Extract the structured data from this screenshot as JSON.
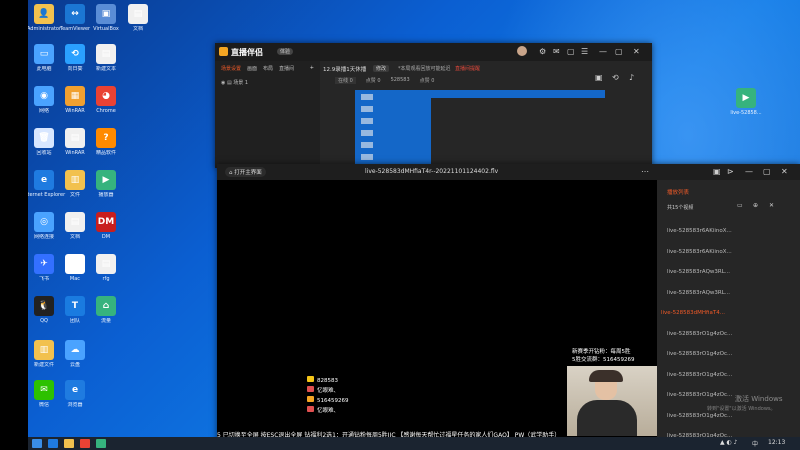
{
  "desktop": {
    "icons": [
      {
        "label": "Administrator",
        "color": "#f2c14e",
        "glyph": "👤"
      },
      {
        "label": "TeamViewer",
        "color": "#1b76d3",
        "glyph": "↔"
      },
      {
        "label": "VirtualBox",
        "color": "#5a8dd6",
        "glyph": "▣"
      },
      {
        "label": "文档",
        "color": "#f0f0f0",
        "glyph": "▤"
      },
      {
        "label": "此电脑",
        "color": "#4aa3ff",
        "glyph": "▭"
      },
      {
        "label": "向日葵",
        "color": "#2aa0ff",
        "glyph": "⟲"
      },
      {
        "label": "新建文本",
        "color": "#f0f0f0",
        "glyph": "▤"
      },
      {
        "label": "网络",
        "color": "#4aa3ff",
        "glyph": "◉"
      },
      {
        "label": "WinRAR",
        "color": "#f0a030",
        "glyph": "▦"
      },
      {
        "label": "Chrome",
        "color": "#e94234",
        "glyph": "◕"
      },
      {
        "label": "回收站",
        "color": "#d7e6ff",
        "glyph": "🗑"
      },
      {
        "label": "WinRAR",
        "color": "#f0f0f0",
        "glyph": "▤"
      },
      {
        "label": "精品软件",
        "color": "#ff8a00",
        "glyph": "?"
      },
      {
        "label": "Internet Explorer",
        "color": "#1f7be0",
        "glyph": "e"
      },
      {
        "label": "文件",
        "color": "#f2c14e",
        "glyph": "▥"
      },
      {
        "label": "播放器",
        "color": "#36b37e",
        "glyph": "▶"
      },
      {
        "label": "网络连接",
        "color": "#4aa3ff",
        "glyph": "◎"
      },
      {
        "label": "文档",
        "color": "#f0f0f0",
        "glyph": "▤"
      },
      {
        "label": "DM",
        "color": "#c81e1e",
        "glyph": "DM"
      },
      {
        "label": "飞书",
        "color": "#3370ff",
        "glyph": "✈"
      },
      {
        "label": "Mac",
        "color": "#ffffff",
        "glyph": "M"
      },
      {
        "label": "rfg",
        "color": "#f0f0f0",
        "glyph": "▤"
      },
      {
        "label": "QQ",
        "color": "#222222",
        "glyph": "🐧"
      },
      {
        "label": "团队",
        "color": "#1a7be0",
        "glyph": "T"
      },
      {
        "label": "流量",
        "color": "#36b37e",
        "glyph": "⌂"
      },
      {
        "label": "新建文件",
        "color": "#f2c14e",
        "glyph": "▥"
      },
      {
        "label": "云盘",
        "color": "#4aa3ff",
        "glyph": "☁"
      },
      {
        "label": "微信",
        "color": "#2dc100",
        "glyph": "✉"
      },
      {
        "label": "浏览器",
        "color": "#1f7be0",
        "glyph": "e"
      }
    ],
    "right_icon": {
      "label": "live-52858..."
    }
  },
  "studio": {
    "logo": "直播伴侣",
    "badge": "体验",
    "tabs": [
      "场景设置",
      "画面",
      "布局",
      "直播间"
    ],
    "add_label": "+",
    "scene_label": "场景 1",
    "live_title": "12.9录播1天休播",
    "edit_label": "修改",
    "notice": "*本局观看回放可能延迟",
    "warn": "直播间提醒",
    "stats": [
      "在线 0",
      "点赞 0",
      "528583",
      "点赞 0"
    ],
    "quick_btn": "录制"
  },
  "player": {
    "open_label": "打开主界面",
    "filename": "live-528583dMHfiaT4r--20221101124402.flv",
    "playlist_title": "播放列表",
    "playlist_count": "共15个视频",
    "items": [
      "live-528583r6AKiinoX...",
      "live-528583r6AKiinoX...",
      "live-528583rAQw3RL...",
      "live-528583rAQw3RL...",
      "live-528583dMHfiaT4...",
      "live-528583rO1g4zOc...",
      "live-528583rO1g4zOc...",
      "live-528583rO1g4zOc...",
      "live-528583rO1g4zOc...",
      "live-528583rO1g4zOc...",
      "live-528583rO1g4zOc..."
    ],
    "active_index": 4,
    "overlay_lines": [
      "新赛季开钻粉：每周5胜",
      "5胜交流群：516459269"
    ],
    "chat_lines": [
      "828583",
      "忆眼难、",
      "516459269",
      "忆眼难、"
    ],
    "ticker": "5  已切换至全屏  按ESC退出全屏    钻福利2选1：开通钻粉每周5胜JJC 【感谢每天帮忙过福星任务的家人们GAO】 PW（武学助手）",
    "activate_title": "激活 Windows",
    "activate_sub": "转到\"设置\"以激活 Windows。"
  },
  "taskbar": {
    "time": "12:13",
    "tray_text": "中"
  }
}
